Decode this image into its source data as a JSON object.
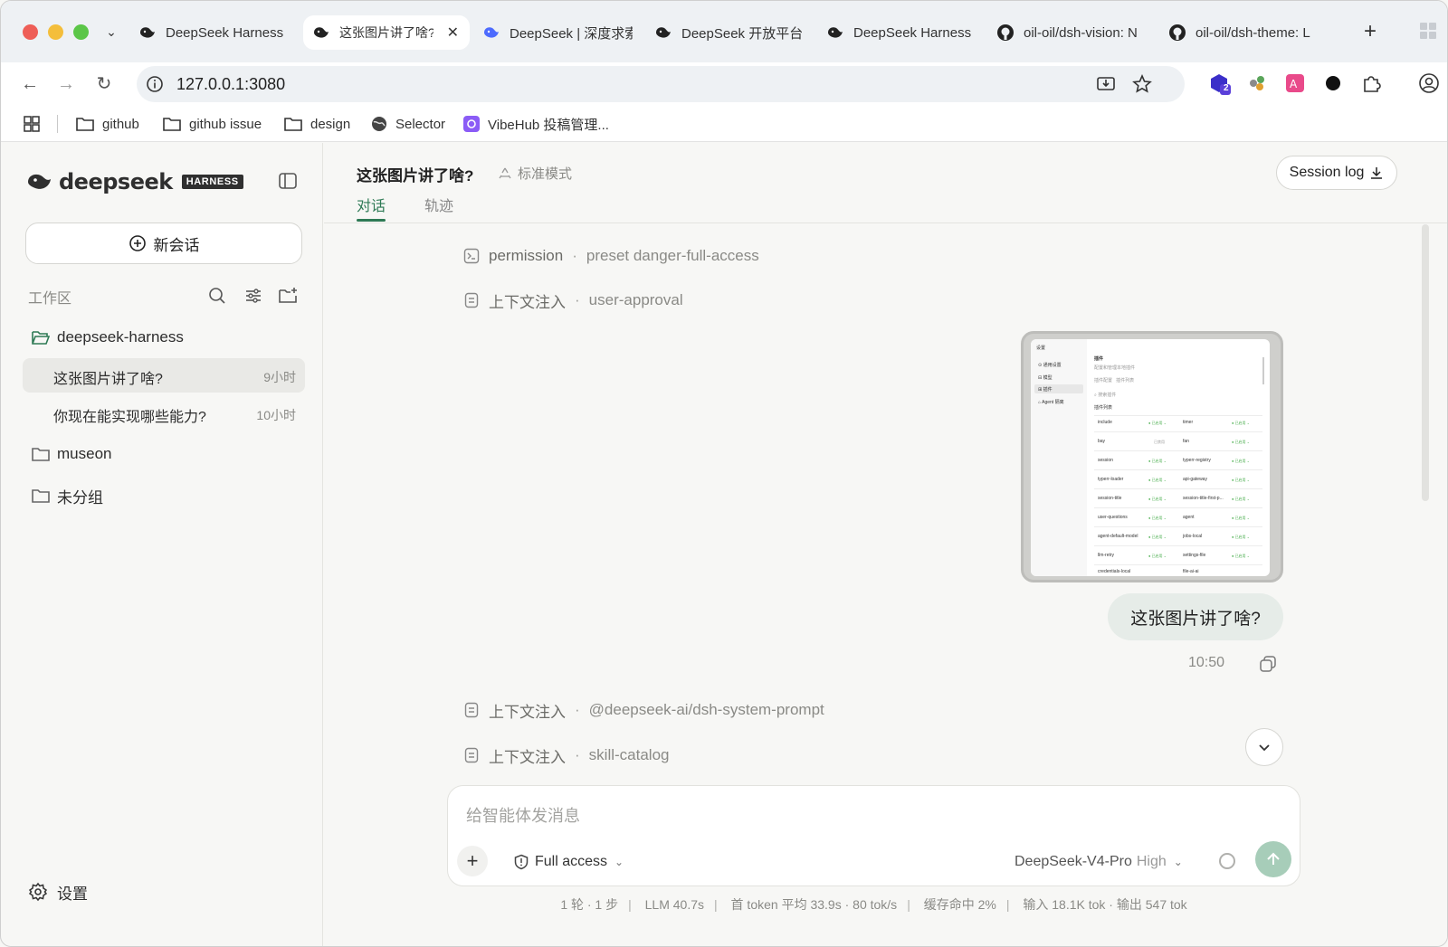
{
  "browser": {
    "tabs": [
      {
        "title": "DeepSeek Harness",
        "active": false
      },
      {
        "title": "这张图片讲了啥?",
        "active": true
      },
      {
        "title": "DeepSeek | 深度求索",
        "active": false
      },
      {
        "title": "DeepSeek 开放平台",
        "active": false
      },
      {
        "title": "DeepSeek Harness",
        "active": false
      },
      {
        "title": "oil-oil/dsh-vision: N",
        "active": false
      },
      {
        "title": "oil-oil/dsh-theme: L",
        "active": false
      }
    ],
    "url": "127.0.0.1:3080",
    "extension_badge": "2",
    "bookmarks": [
      "github",
      "github issue",
      "design",
      "Selector",
      "VibeHub 投稿管理..."
    ]
  },
  "sidebar": {
    "brand": "deepseek",
    "brand_badge": "HARNESS",
    "new_chat": "新会话",
    "workspace_label": "工作区",
    "folders": [
      {
        "name": "deepseek-harness",
        "open": true
      },
      {
        "name": "museon",
        "open": false
      },
      {
        "name": "未分组",
        "open": false
      }
    ],
    "chats": [
      {
        "title": "这张图片讲了啥?",
        "time": "9小时",
        "selected": true
      },
      {
        "title": "你现在能实现哪些能力?",
        "time": "10小时",
        "selected": false
      }
    ],
    "settings": "设置"
  },
  "header": {
    "title": "这张图片讲了啥?",
    "mode": "标准模式",
    "tabs": [
      "对话",
      "轨迹"
    ],
    "session_log": "Session log"
  },
  "events": [
    {
      "key": "permission",
      "value": "preset danger-full-access",
      "icon": "terminal-icon"
    },
    {
      "key": "上下文注入",
      "value": "user-approval",
      "icon": "doc-icon"
    },
    {
      "key": "上下文注入",
      "value": "@deepseek-ai/dsh-system-prompt",
      "icon": "doc-icon"
    },
    {
      "key": "上下文注入",
      "value": "skill-catalog",
      "icon": "doc-icon"
    }
  ],
  "message": {
    "text": "这张图片讲了啥?",
    "time": "10:50"
  },
  "composer": {
    "placeholder": "给智能体发消息",
    "access": "Full access",
    "model": "DeepSeek-V4-Pro",
    "level": "High"
  },
  "stats": [
    "1 轮 · 1 步",
    "LLM 40.7s",
    "首 token 平均 33.9s · 80 tok/s",
    "缓存命中 2%",
    "输入 18.1K tok · 输出 547 tok"
  ],
  "colors": {
    "accent": "#2e7a55",
    "send": "#a7cdb9",
    "bubble": "#e6ece8"
  }
}
